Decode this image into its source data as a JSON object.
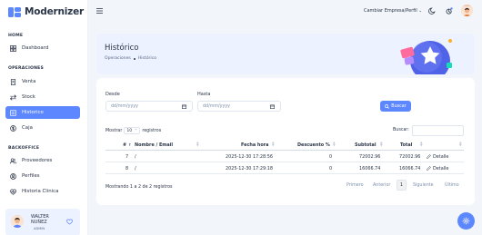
{
  "app": {
    "name": "Modernizer"
  },
  "sidebar": {
    "sections": [
      {
        "title": "HOME",
        "items": [
          {
            "label": "Dashboard",
            "icon": "dashboard-icon"
          }
        ]
      },
      {
        "title": "OPERACIONES",
        "items": [
          {
            "label": "Venta",
            "icon": "receipt-icon"
          },
          {
            "label": "Stock",
            "icon": "arrows-icon"
          },
          {
            "label": "Historico",
            "icon": "list-icon",
            "active": true
          },
          {
            "label": "Caja",
            "icon": "cash-icon"
          }
        ]
      },
      {
        "title": "BACKOFFICE",
        "items": [
          {
            "label": "Proveedores",
            "icon": "users-icon"
          },
          {
            "label": "Perfiles",
            "icon": "profile-icon"
          },
          {
            "label": "Historia Clinica",
            "icon": "clinic-icon"
          }
        ]
      }
    ],
    "user": {
      "name": "WALTER NUÑEZ",
      "role": "ADMIN"
    }
  },
  "topbar": {
    "company": "Cambiar Empresa/Perfil"
  },
  "header": {
    "title": "Histórico",
    "breadcrumb": [
      "Operaciones",
      "Histórico"
    ]
  },
  "filters": {
    "desde_label": "Desde",
    "hasta_label": "Hasta",
    "desde_placeholder": "dd/mm/yyyy",
    "hasta_placeholder": "dd/mm/yyyy",
    "buscar_button": "Buscar"
  },
  "table_controls": {
    "show_prefix": "Mostrar",
    "page_size": "10",
    "show_suffix": "registros",
    "search_label": "Buscar:"
  },
  "table": {
    "columns": [
      "#",
      "Nombre / Email",
      "Fecha hora",
      "Descuento %",
      "Subtotal",
      "Total",
      ""
    ],
    "rows": [
      {
        "id": "7",
        "nombre": "/",
        "fecha": "2025-12-30 17:28:56",
        "descuento": "0",
        "subtotal": "72002.96",
        "total": "72002.96",
        "action": "Detalle"
      },
      {
        "id": "8",
        "nombre": "/",
        "fecha": "2025-12-30 17:29:18",
        "descuento": "0",
        "subtotal": "16066.74",
        "total": "16066.74",
        "action": "Detalle"
      }
    ]
  },
  "footer": {
    "info": "Mostrando 1 a 2 de 2 registros",
    "pager": {
      "first": "Primero",
      "prev": "Anterior",
      "current": "1",
      "next": "Siguiente",
      "last": "Último"
    }
  },
  "colors": {
    "primary": "#5d87ff",
    "header_bg": "#ecf2ff",
    "text": "#2a3547"
  }
}
